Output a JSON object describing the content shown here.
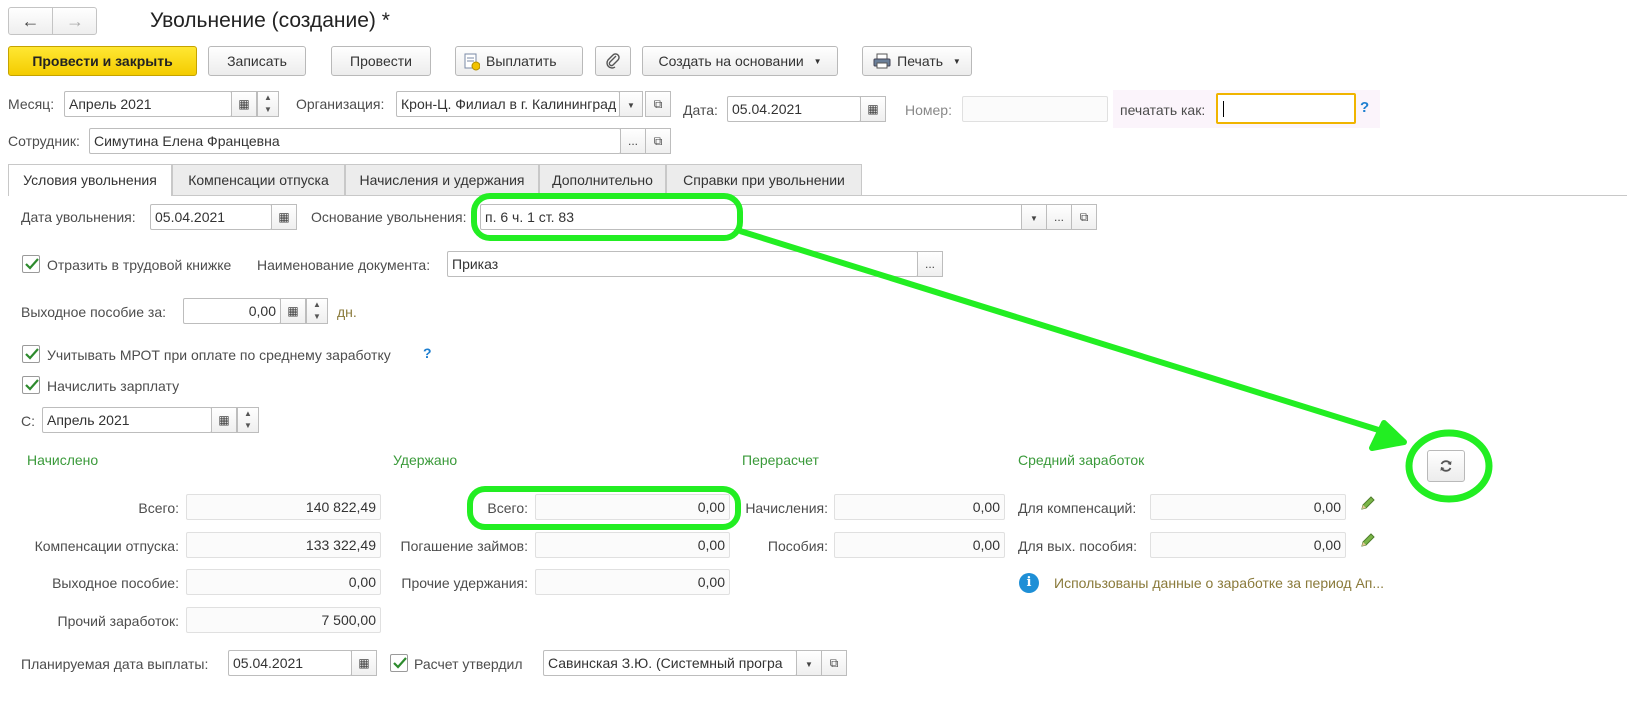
{
  "window": {
    "title": "Увольнение (создание) *"
  },
  "toolbar": {
    "post_close": "Провести и закрыть",
    "save": "Записать",
    "post": "Провести",
    "pay": "Выплатить",
    "create_based": "Создать на основании",
    "print": "Печать"
  },
  "header": {
    "month_label": "Месяц:",
    "month_value": "Апрель 2021",
    "org_label": "Организация:",
    "org_value": "Крон-Ц. Филиал в г. Калининград",
    "date_label": "Дата:",
    "date_value": "05.04.2021",
    "number_label": "Номер:",
    "number_value": "",
    "print_as_label": "печатать как:",
    "print_as_value": "",
    "help": "?",
    "employee_label": "Сотрудник:",
    "employee_value": "Симутина Елена Францевна",
    "ellipsis": "..."
  },
  "tabs": [
    {
      "label": "Условия увольнения",
      "active": true
    },
    {
      "label": "Компенсации отпуска",
      "active": false
    },
    {
      "label": "Начисления и удержания",
      "active": false
    },
    {
      "label": "Дополнительно",
      "active": false
    },
    {
      "label": "Справки при увольнении",
      "active": false
    }
  ],
  "form": {
    "dismissal_date_label": "Дата увольнения:",
    "dismissal_date_value": "05.04.2021",
    "basis_label": "Основание увольнения:",
    "basis_value": "п. 6 ч. 1 ст. 83",
    "reflect_book_label": "Отразить в трудовой книжке",
    "reflect_book_checked": true,
    "doc_name_label": "Наименование документа:",
    "doc_name_value": "Приказ",
    "severance_label": "Выходное пособие за:",
    "severance_value": "0,00",
    "severance_unit": "дн.",
    "mrot_label": "Учитывать МРОТ при оплате по среднему заработку",
    "mrot_checked": true,
    "accrue_salary_label": "Начислить зарплату",
    "accrue_salary_checked": true,
    "from_label": "С:",
    "from_value": "Апрель 2021"
  },
  "accrued": {
    "title": "Начислено",
    "rows": [
      {
        "label": "Всего:",
        "value": "140 822,49"
      },
      {
        "label": "Компенсации отпуска:",
        "value": "133 322,49"
      },
      {
        "label": "Выходное пособие:",
        "value": "0,00"
      },
      {
        "label": "Прочий заработок:",
        "value": "7 500,00"
      }
    ]
  },
  "withheld": {
    "title": "Удержано",
    "rows": [
      {
        "label": "Всего:",
        "value": "0,00"
      },
      {
        "label": "Погашение займов:",
        "value": "0,00"
      },
      {
        "label": "Прочие удержания:",
        "value": "0,00"
      }
    ]
  },
  "recalc": {
    "title": "Перерасчет",
    "rows": [
      {
        "label": "Начисления:",
        "value": "0,00"
      },
      {
        "label": "Пособия:",
        "value": "0,00"
      }
    ]
  },
  "avg_earnings": {
    "title": "Средний заработок",
    "rows": [
      {
        "label": "Для компенсаций:",
        "value": "0,00"
      },
      {
        "label": "Для вых. пособия:",
        "value": "0,00"
      }
    ],
    "info": "Использованы данные о заработке за период Ап..."
  },
  "footer": {
    "planned_date_label": "Планируемая дата выплаты:",
    "planned_date_value": "05.04.2021",
    "approved_label": "Расчет утвердил",
    "approved_checked": true,
    "approved_value": "Савинская З.Ю. (Системный програ"
  },
  "colors": {
    "annotation": "#22ee22",
    "primary_button": "#f4cc00",
    "section_title": "#3a9a3a",
    "help": "#1e7fd0",
    "focus_border": "#f0b400"
  }
}
